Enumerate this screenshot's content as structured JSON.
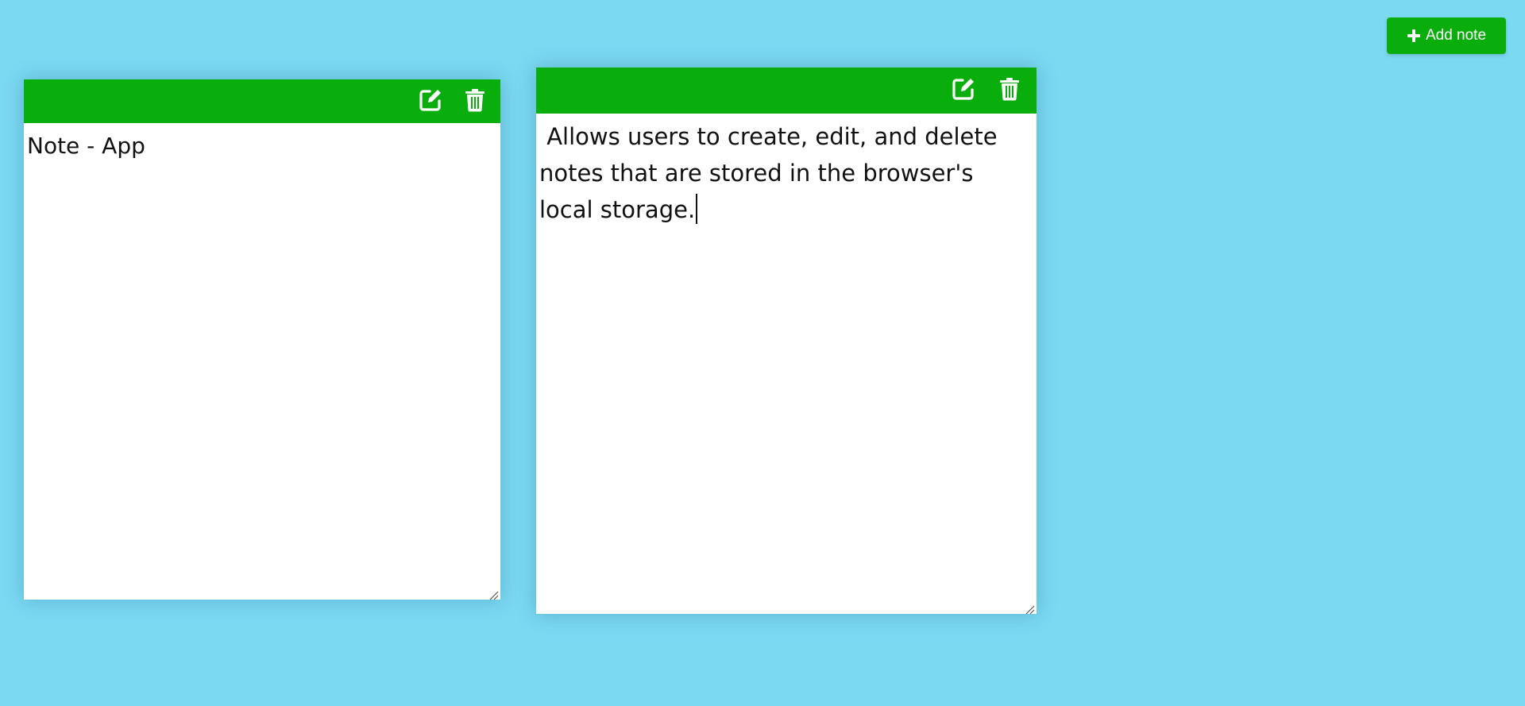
{
  "header": {
    "add_button_label": "Add note",
    "add_button_icon": "plus-icon"
  },
  "notes": [
    {
      "text": "Note - App",
      "edit_icon": "edit-icon",
      "delete_icon": "trash-icon"
    },
    {
      "text": " Allows users to create, edit, and delete notes that are stored in the browser's local storage.",
      "edit_icon": "edit-icon",
      "delete_icon": "trash-icon"
    }
  ],
  "colors": {
    "background": "#7bd9f2",
    "accent": "#0aae0c",
    "note_background": "#ffffff",
    "text": "#111111"
  }
}
